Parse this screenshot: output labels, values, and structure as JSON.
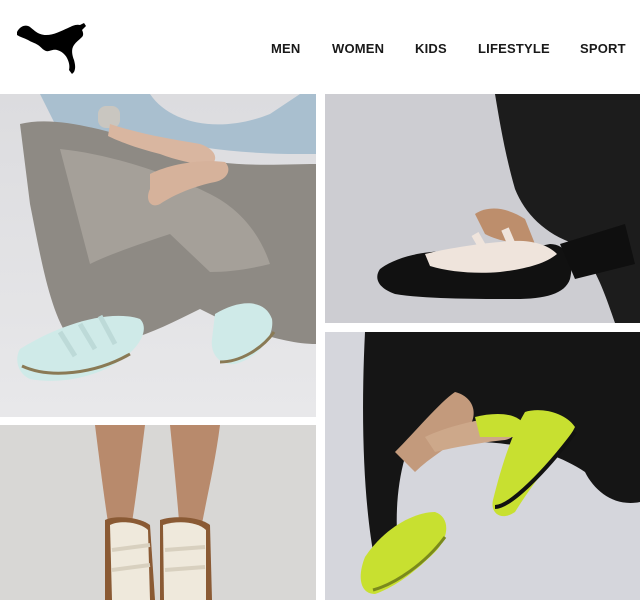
{
  "brand": {
    "logo_icon": "puma-cat-logo-icon",
    "color": "#000000"
  },
  "nav": {
    "items": [
      {
        "label": "MEN"
      },
      {
        "label": "WOMEN"
      },
      {
        "label": "KIDS"
      },
      {
        "label": "LIFESTYLE"
      },
      {
        "label": "SPORT"
      }
    ]
  },
  "gallery": {
    "images": [
      {
        "subject": "person seated cross-legged in grey wide-leg jeans wearing mint ballet-flat sneakers",
        "shoe_color": "#cfeae8"
      },
      {
        "subject": "black and cream ballet-flat sneaker with crisscross straps on a foot",
        "shoe_color": "#111111"
      },
      {
        "subject": "feet wearing cream and brown strappy ballet-flat sneakers",
        "shoe_color": "#efe9dc"
      },
      {
        "subject": "person in black trousers holding lime green ballet-flat sneakers",
        "shoe_color": "#c8e030"
      }
    ]
  }
}
